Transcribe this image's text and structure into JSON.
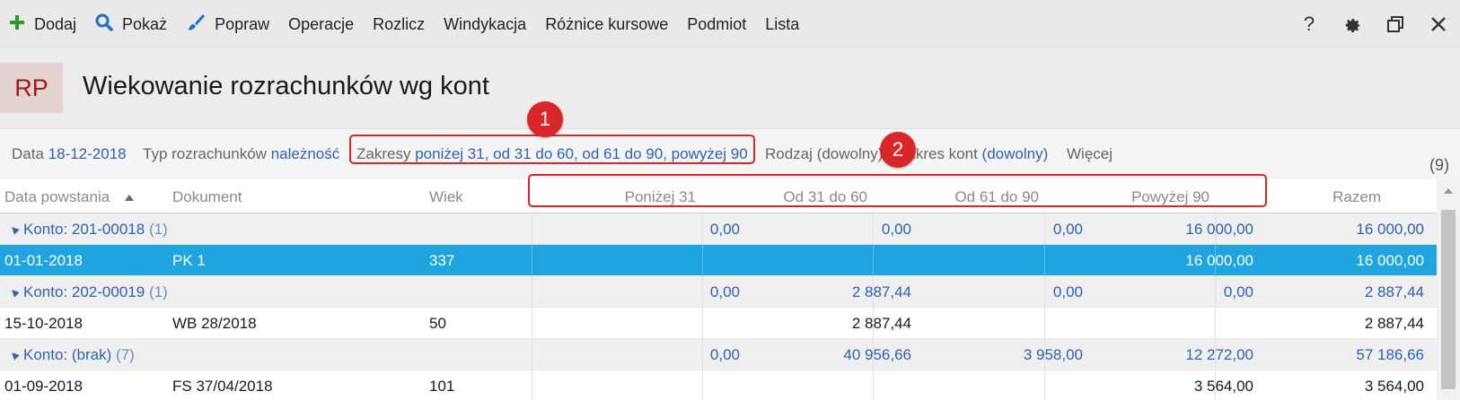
{
  "toolbar": {
    "items": [
      {
        "label": "Dodaj",
        "icon": "plus-icon"
      },
      {
        "label": "Pokaż",
        "icon": "search-icon"
      },
      {
        "label": "Popraw",
        "icon": "brush-icon"
      },
      {
        "label": "Operacje"
      },
      {
        "label": "Rozlicz"
      },
      {
        "label": "Windykacja"
      },
      {
        "label": "Różnice kursowe"
      },
      {
        "label": "Podmiot"
      },
      {
        "label": "Lista"
      }
    ],
    "help": "?"
  },
  "header": {
    "badge": "RP",
    "title": "Wiekowanie rozrachunków wg kont"
  },
  "filters": {
    "data_label": "Data",
    "data_value": "18-12-2018",
    "typ_label": "Typ rozrachunków",
    "typ_value": "należność",
    "zakresy_label": "Zakresy",
    "zakresy_value": "poniżej 31, od 31 do 60, od 61 do 90, powyżej 90",
    "rodzaj_label": "Rodzaj",
    "rodzaj_value": "(dowolny)",
    "zakres_kont_label": "Zakres kont",
    "zakres_kont_value": "(dowolny)",
    "wiecej": "Więcej",
    "count": "(9)"
  },
  "table": {
    "columns": {
      "data": "Data powstania",
      "dokument": "Dokument",
      "wiek": "Wiek",
      "p31": "Poniżej 31",
      "p60": "Od 31 do 60",
      "p90": "Od 61 do 90",
      "pow90": "Powyżej 90",
      "razem": "Razem"
    },
    "rows": [
      {
        "kind": "group",
        "label": "Konto:",
        "account": "201-00018",
        "count": "(1)",
        "p31": "0,00",
        "p60": "0,00",
        "p90": "0,00",
        "pow90": "16 000,00",
        "razem": "16 000,00"
      },
      {
        "kind": "sel",
        "data": "01-01-2018",
        "dokument": "PK 1",
        "wiek": "337",
        "p31": "",
        "p60": "",
        "p90": "",
        "pow90": "16 000,00",
        "razem": "16 000,00"
      },
      {
        "kind": "group",
        "label": "Konto:",
        "account": "202-00019",
        "count": "(1)",
        "p31": "0,00",
        "p60": "2 887,44",
        "p90": "0,00",
        "pow90": "0,00",
        "razem": "2 887,44"
      },
      {
        "kind": "data",
        "data": "15-10-2018",
        "dokument": "WB 28/2018",
        "wiek": "50",
        "p31": "",
        "p60": "2 887,44",
        "p90": "",
        "pow90": "",
        "razem": "2 887,44"
      },
      {
        "kind": "group",
        "label": "Konto:",
        "account": "(brak)",
        "count": "(7)",
        "p31": "0,00",
        "p60": "40 956,66",
        "p90": "3 958,00",
        "pow90": "12 272,00",
        "razem": "57 186,66"
      },
      {
        "kind": "data",
        "data": "01-09-2018",
        "dokument": "FS 37/04/2018",
        "wiek": "101",
        "p31": "",
        "p60": "",
        "p90": "",
        "pow90": "3 564,00",
        "razem": "3 564,00"
      }
    ]
  },
  "annotations": {
    "marker1": "1",
    "marker2": "2"
  },
  "colors": {
    "accent_blue": "#2f62b0",
    "selection": "#1ea5e0",
    "annotation_red": "#d8262a",
    "badge_text": "#a01818",
    "badge_bg": "#e3d3d1"
  }
}
